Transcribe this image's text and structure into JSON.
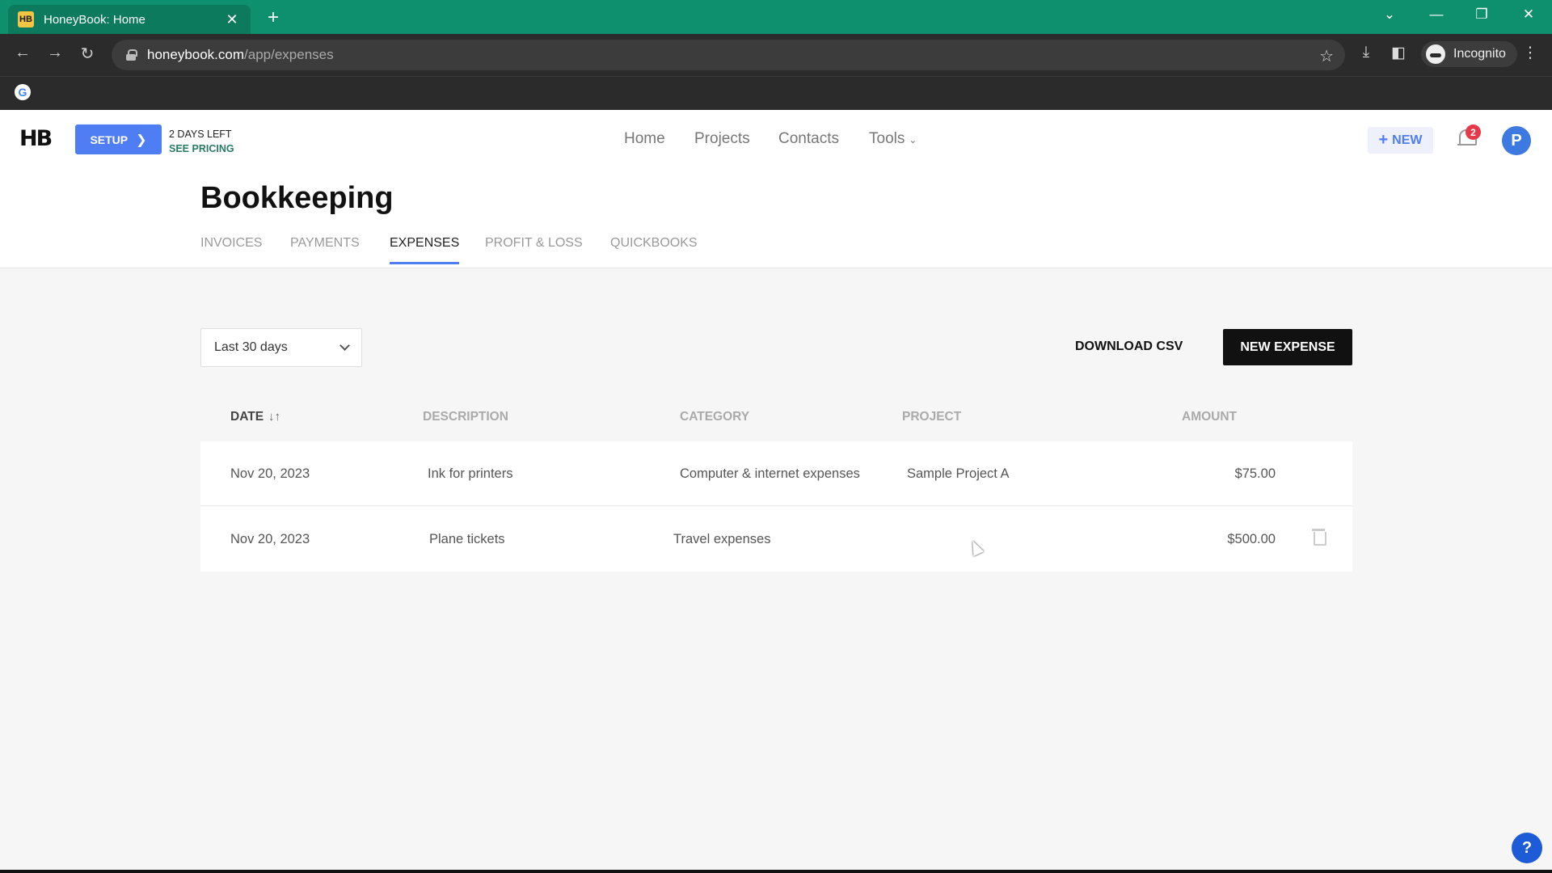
{
  "browser": {
    "tab_title": "HoneyBook: Home",
    "tab_favicon": "HB",
    "url_host": "honeybook.com",
    "url_path": "/app/expenses",
    "profile_label": "Incognito"
  },
  "header": {
    "logo": "HB",
    "setup_label": "SETUP",
    "trial_days": "2 DAYS LEFT",
    "trial_link": "SEE PRICING",
    "nav": {
      "home": "Home",
      "projects": "Projects",
      "contacts": "Contacts",
      "tools": "Tools"
    },
    "new_label": "NEW",
    "notification_count": "2",
    "avatar_initial": "P"
  },
  "page": {
    "title": "Bookkeeping",
    "tabs": {
      "invoices": "INVOICES",
      "payments": "PAYMENTS",
      "expenses": "EXPENSES",
      "profit_loss": "PROFIT & LOSS",
      "quickbooks": "QUICKBOOKS"
    },
    "active_tab": "EXPENSES"
  },
  "controls": {
    "range": "Last 30 days",
    "download_csv": "DOWNLOAD CSV",
    "new_expense": "NEW EXPENSE"
  },
  "table": {
    "headers": {
      "date": "DATE",
      "description": "DESCRIPTION",
      "category": "CATEGORY",
      "project": "PROJECT",
      "amount": "AMOUNT"
    },
    "rows": [
      {
        "date": "Nov 20, 2023",
        "description": "Ink for printers",
        "category": "Computer & internet expenses",
        "project": "Sample Project A",
        "amount": "$75.00"
      },
      {
        "date": "Nov 20, 2023",
        "description": "Plane tickets",
        "category": "Travel expenses",
        "project": "",
        "amount": "$500.00"
      }
    ]
  },
  "help_label": "?",
  "colors": {
    "accent": "#4f7df3",
    "browser_frame": "#0e8f6e",
    "badge": "#e8394a",
    "primary_button": "#111111"
  }
}
